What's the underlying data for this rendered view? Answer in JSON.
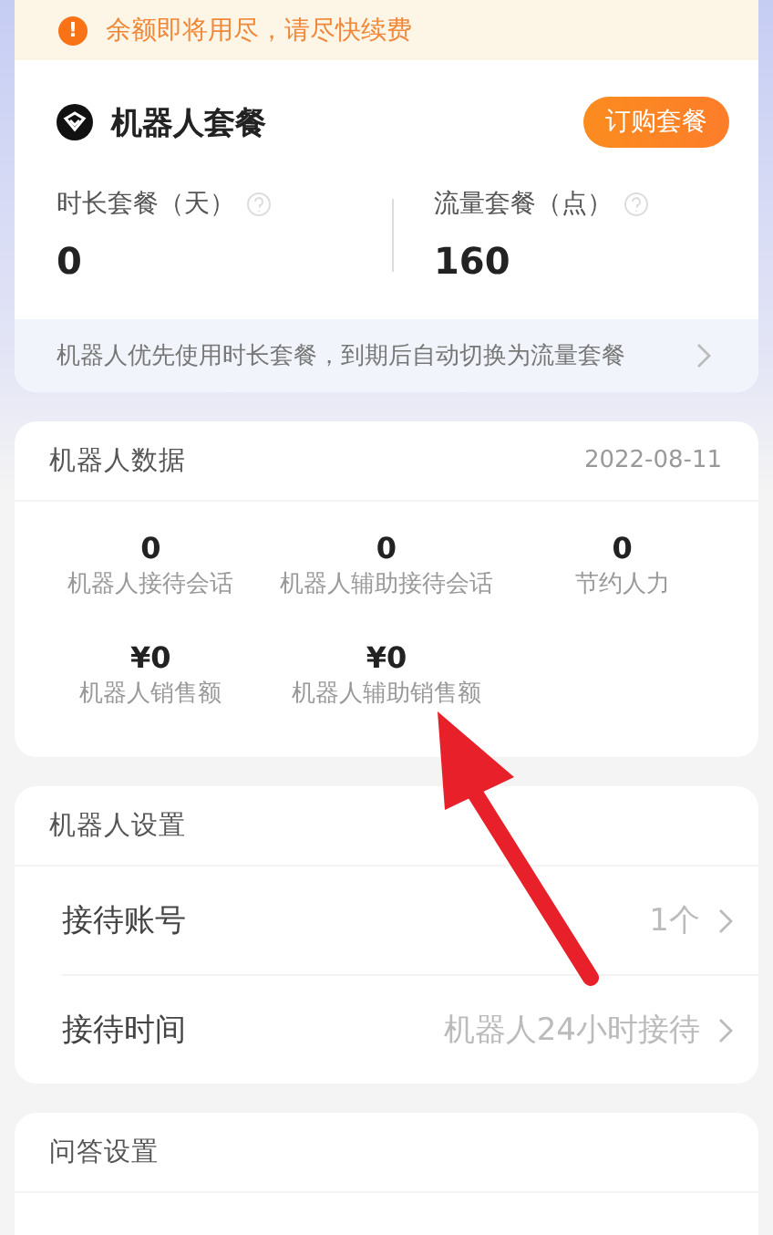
{
  "notice": {
    "icon": "!",
    "text": "余额即将用尽，请尽快续费"
  },
  "package": {
    "title": "机器人套餐",
    "button": "订购套餐",
    "metrics": [
      {
        "label": "时长套餐（天）",
        "value": "0"
      },
      {
        "label": "流量套餐（点）",
        "value": "160"
      }
    ],
    "footer": "机器人优先使用时长套餐，到期后自动切换为流量套餐"
  },
  "data": {
    "title": "机器人数据",
    "date": "2022-08-11",
    "stats": [
      {
        "value": "0",
        "label": "机器人接待会话"
      },
      {
        "value": "0",
        "label": "机器人辅助接待会话"
      },
      {
        "value": "0",
        "label": "节约人力"
      },
      {
        "value": "¥0",
        "label": "机器人销售额"
      },
      {
        "value": "¥0",
        "label": "机器人辅助销售额"
      }
    ]
  },
  "settings": {
    "title": "机器人设置",
    "rows": [
      {
        "label": "接待账号",
        "value": "1个"
      },
      {
        "label": "接待时间",
        "value": "机器人24小时接待"
      }
    ]
  },
  "qa": {
    "title": "问答设置"
  }
}
